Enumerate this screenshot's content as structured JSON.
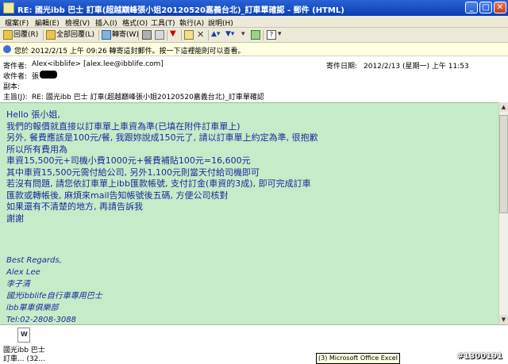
{
  "window": {
    "title": "RE: 國光ibb 巴士 訂車(超越巔峰張小姐20120520嘉義台北)_訂車單確認 - 郵件 (HTML)",
    "min_label": "_",
    "max_label": "□",
    "close_label": "✕"
  },
  "menu": [
    "檔案(F)",
    "編輯(E)",
    "檢視(V)",
    "插入(I)",
    "格式(O)",
    "工具(T)",
    "執行(A)",
    "說明(H)"
  ],
  "toolbar": {
    "reply_label": "回覆(R)",
    "reply_all_label": "全部回覆(L)",
    "forward_label": "轉寄(W)"
  },
  "infobar": {
    "text": "您於 2012/2/15 上午 09:26 轉寄這封郵件。按一下這裡能則可以查看。"
  },
  "headers": {
    "from_label": "寄件者:",
    "from_value": "Alex<ibblife> [alex.lee@ibblife.com]",
    "to_label": "收件者:",
    "to_value": "張",
    "cc_label": "副本:",
    "cc_value": "",
    "subject_label": "主旨(J):",
    "subject_value": "RE: 國光ibb 巴士 訂車(超越巔峰張小姐20120520嘉義台北)_訂車單確認",
    "sent_label": "寄件日期:",
    "sent_value": "2012/2/13 (星期一) 上午  11:53"
  },
  "message": {
    "lines": [
      "Hello 張小姐,",
      "我們的報價就直接以訂車單上車資為準(已填在附件訂車單上)",
      "另外, 餐費應該是100元/餐, 我跟妳說成150元了, 請以訂車單上約定為準, 很抱歉",
      "所以所有費用為",
      "車資15,500元+司機小費1000元+餐費補貼100元=16,600元",
      "其中車資15,500元需付給公司, 另外1,100元則當天付給司機即可",
      "若沒有問題, 請您依訂車單上ibb匯款帳號, 支付訂金(車資的3成), 即可完成訂車",
      "匯款或轉帳後, 麻煩來mail告知帳號後五碼, 方便公司核對",
      "如果還有不清楚的地方, 再請告訴我",
      "謝謝"
    ],
    "signature": [
      "Best Regards,",
      "  Alex Lee",
      "李子清",
      "國光ibblife自行車專用巴士",
      "ibb單車俱樂部",
      "  Tel:02-2808-3088"
    ]
  },
  "attachment": {
    "name_line1": "國光ibb 巴士",
    "name_line2": "訂車... (32..."
  },
  "tooltip": "(3) Microsoft Office Excel",
  "watermark": "#1300191"
}
